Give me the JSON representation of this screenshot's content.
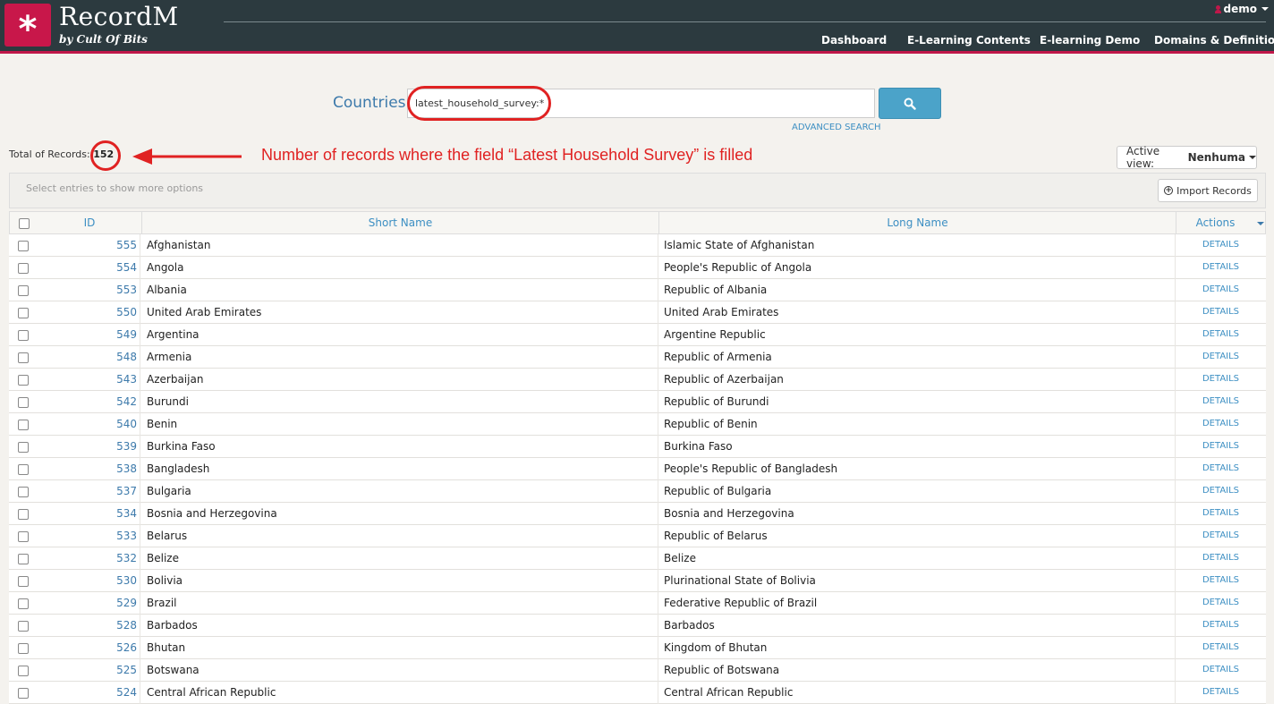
{
  "header": {
    "logo_glyph": "*",
    "brand": "RecordM",
    "brand_sub": "by Cult Of Bits",
    "user": "demo",
    "nav": [
      "Dashboard",
      "E-Learning Contents",
      "E-learning Demo",
      "Domains & Definitions"
    ]
  },
  "search": {
    "label": "Countries",
    "value": "latest_household_survey:*",
    "advanced": "ADVANCED SEARCH"
  },
  "total": {
    "label": "Total of Records:",
    "count": "152"
  },
  "annotation": {
    "text": "Number of records where the field “Latest Household Survey” is filled",
    "color": "#e02222"
  },
  "active_view": {
    "label": "Active view:",
    "value": "Nenhuma"
  },
  "toolbar": {
    "hint": "Select entries to show more options",
    "import_label": "Import Records"
  },
  "table": {
    "columns": [
      "ID",
      "Short Name",
      "Long Name",
      "Actions"
    ],
    "action_label": "DETAILS",
    "rows": [
      {
        "id": "555",
        "short": "Afghanistan",
        "long": "Islamic State of Afghanistan"
      },
      {
        "id": "554",
        "short": "Angola",
        "long": "People's Republic of Angola"
      },
      {
        "id": "553",
        "short": "Albania",
        "long": "Republic of Albania"
      },
      {
        "id": "550",
        "short": "United Arab Emirates",
        "long": "United Arab Emirates"
      },
      {
        "id": "549",
        "short": "Argentina",
        "long": "Argentine Republic"
      },
      {
        "id": "548",
        "short": "Armenia",
        "long": "Republic of Armenia"
      },
      {
        "id": "543",
        "short": "Azerbaijan",
        "long": "Republic of Azerbaijan"
      },
      {
        "id": "542",
        "short": "Burundi",
        "long": "Republic of Burundi"
      },
      {
        "id": "540",
        "short": "Benin",
        "long": "Republic of Benin"
      },
      {
        "id": "539",
        "short": "Burkina Faso",
        "long": "Burkina Faso"
      },
      {
        "id": "538",
        "short": "Bangladesh",
        "long": "People's Republic of Bangladesh"
      },
      {
        "id": "537",
        "short": "Bulgaria",
        "long": "Republic of Bulgaria"
      },
      {
        "id": "534",
        "short": "Bosnia and Herzegovina",
        "long": "Bosnia and Herzegovina"
      },
      {
        "id": "533",
        "short": "Belarus",
        "long": "Republic of Belarus"
      },
      {
        "id": "532",
        "short": "Belize",
        "long": "Belize"
      },
      {
        "id": "530",
        "short": "Bolivia",
        "long": "Plurinational State of Bolivia"
      },
      {
        "id": "529",
        "short": "Brazil",
        "long": "Federative Republic of Brazil"
      },
      {
        "id": "528",
        "short": "Barbados",
        "long": "Barbados"
      },
      {
        "id": "526",
        "short": "Bhutan",
        "long": "Kingdom of Bhutan"
      },
      {
        "id": "525",
        "short": "Botswana",
        "long": "Republic of Botswana"
      },
      {
        "id": "524",
        "short": "Central African Republic",
        "long": "Central African Republic"
      }
    ]
  },
  "colors": {
    "header_bg": "#2c3a3f",
    "brand_accent": "#c8174a",
    "link_blue": "#3d8fc3",
    "search_button": "#4ba3c9"
  }
}
